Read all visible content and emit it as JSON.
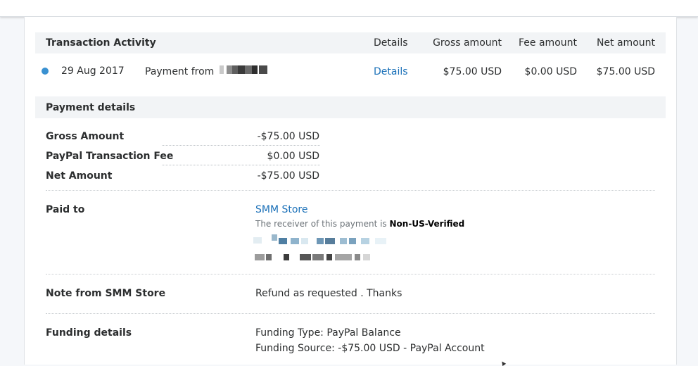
{
  "activity": {
    "title": "Transaction Activity",
    "col_details": "Details",
    "col_gross": "Gross amount",
    "col_fee": "Fee amount",
    "col_net": "Net amount",
    "row": {
      "date": "29 Aug 2017",
      "description": "Payment from",
      "details_link": "Details",
      "gross": "$75.00 USD",
      "fee": "$0.00 USD",
      "net": "$75.00 USD",
      "status_color": "#3a91d1"
    }
  },
  "payment_details": {
    "title": "Payment details",
    "gross_label": "Gross Amount",
    "gross_value": "-$75.00 USD",
    "fee_label": "PayPal Transaction Fee",
    "fee_value": "$0.00 USD",
    "net_label": "Net Amount",
    "net_value": "-$75.00 USD",
    "paid_to_label": "Paid to",
    "paid_to_name": "SMM Store",
    "receiver_text": "The receiver of this payment is",
    "receiver_status": "Non-US-Verified",
    "note_label": "Note from SMM Store",
    "note_value": "Refund as requested . Thanks",
    "funding_label": "Funding details",
    "funding_type": "Funding Type: PayPal Balance",
    "funding_source": "Funding Source: -$75.00 USD - PayPal Account"
  },
  "colors": {
    "link": "#1a70b8",
    "header_bg": "#f2f4f6",
    "status_dot": "#3a91d1"
  }
}
